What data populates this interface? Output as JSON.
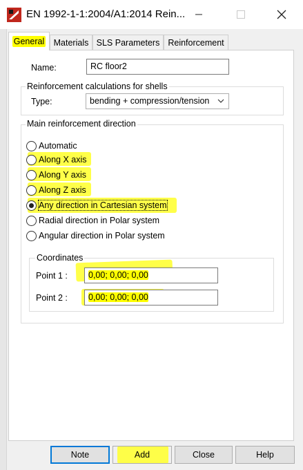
{
  "window": {
    "title": "EN 1992-1-1:2004/A1:2014 Rein...",
    "app_icon": "structural-app-icon",
    "controls": {
      "minimize": "minimize-icon",
      "maximize": "maximize-icon",
      "close": "close-icon"
    }
  },
  "tabs": [
    {
      "label": "General",
      "active": true
    },
    {
      "label": "Materials",
      "active": false
    },
    {
      "label": "SLS Parameters",
      "active": false
    },
    {
      "label": "Reinforcement",
      "active": false
    }
  ],
  "general": {
    "name_label": "Name:",
    "name_value": "RC floor2",
    "shells_group": {
      "title": "Reinforcement calculations for shells",
      "type_label": "Type:",
      "type_value": "bending + compression/tension"
    },
    "direction_group": {
      "title": "Main reinforcement direction",
      "options": [
        {
          "label": "Automatic",
          "checked": false
        },
        {
          "label": "Along X axis",
          "checked": false
        },
        {
          "label": "Along Y axis",
          "checked": false
        },
        {
          "label": "Along Z axis",
          "checked": false
        },
        {
          "label": "Any direction in Cartesian system",
          "checked": true
        },
        {
          "label": "Radial direction in Polar system",
          "checked": false
        },
        {
          "label": "Angular direction in Polar system",
          "checked": false
        }
      ],
      "coordinates": {
        "title": "Coordinates",
        "point1_label": "Point 1 :",
        "point1_value": "0,00; 0,00; 0,00",
        "point2_label": "Point 2 :",
        "point2_value": "0,00; 0,00; 0,00"
      }
    }
  },
  "buttons": {
    "note": "Note",
    "add": "Add",
    "close": "Close",
    "help": "Help"
  },
  "colors": {
    "highlight": "#ffff00",
    "focus_border": "#0078d7",
    "window_bg": "#f0f0f0",
    "panel_bg": "#ffffff"
  }
}
